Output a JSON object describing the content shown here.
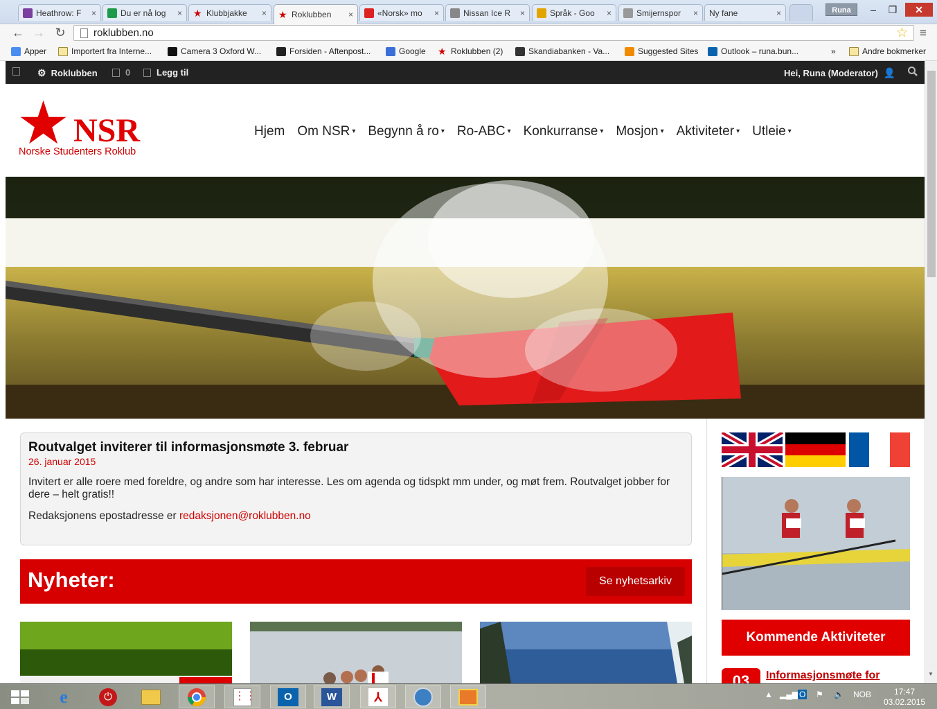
{
  "browser": {
    "tabs": [
      {
        "title": "Heathrow: F",
        "icon": "calendar-icon",
        "color": "#7b3fa0"
      },
      {
        "title": "Du er nå log",
        "icon": "green-h-icon",
        "color": "#1e9a4a"
      },
      {
        "title": "Klubbjakke",
        "icon": "star-icon",
        "color": "#d00000"
      },
      {
        "title": "Roklubben",
        "icon": "star-icon",
        "color": "#d00000"
      },
      {
        "title": "«Norsk» mo",
        "icon": "vg-icon",
        "color": "#d22"
      },
      {
        "title": "Nissan Ice R",
        "icon": "nissan-icon",
        "color": "#888"
      },
      {
        "title": "Språk - Goo",
        "icon": "chart-icon",
        "color": "#e2a400"
      },
      {
        "title": "Smijernspor",
        "icon": "page-icon",
        "color": "#999"
      },
      {
        "title": "Ny fane",
        "icon": "",
        "color": ""
      }
    ],
    "tab_close": "×",
    "user_button": "Runa",
    "url": "roklubben.no",
    "nav": {
      "back": "←",
      "forward": "→",
      "reload": "↻"
    },
    "star": "☆",
    "menu": "≡",
    "bookmarks": [
      {
        "label": "Apper",
        "icon": "apps-icon"
      },
      {
        "label": "Importert fra Interne...",
        "icon": "folder-icon"
      },
      {
        "label": "Camera 3 Oxford W...",
        "icon": "oi-icon"
      },
      {
        "label": "Forsiden - Aftenpost...",
        "icon": "aftenposten-icon"
      },
      {
        "label": "Google",
        "icon": "google-icon"
      },
      {
        "label": "Roklubben (2)",
        "icon": "star-icon"
      },
      {
        "label": "Skandiabanken - Va...",
        "icon": "skandia-icon"
      },
      {
        "label": "Suggested Sites",
        "icon": "suggested-icon"
      },
      {
        "label": "Outlook – runa.bun...",
        "icon": "outlook-icon"
      }
    ],
    "bookmarks_more": "»",
    "other_bookmarks": "Andre bokmerker"
  },
  "adminbar": {
    "site": "Roklubben",
    "comments": "0",
    "add": "Legg til",
    "greeting": "Hei, Runa (Moderator)"
  },
  "site": {
    "logo_text": "NSR",
    "logo_sub": "Norske Studenters Roklub",
    "nav": [
      {
        "label": "Hjem",
        "dropdown": false
      },
      {
        "label": "Om NSR",
        "dropdown": true
      },
      {
        "label": "Begynn å ro",
        "dropdown": true
      },
      {
        "label": "Ro-ABC",
        "dropdown": true
      },
      {
        "label": "Konkurranse",
        "dropdown": true
      },
      {
        "label": "Mosjon",
        "dropdown": true
      },
      {
        "label": "Aktiviteter",
        "dropdown": true
      },
      {
        "label": "Utleie",
        "dropdown": true
      }
    ]
  },
  "notice": {
    "title": "Routvalget inviterer til informasjonsmøte 3. februar",
    "date": "26. januar 2015",
    "body": "Invitert er alle roere med foreldre, og andre som har interesse. Les om agenda og tidspkt mm under, og møt frem. Routvalget jobber for dere – helt gratis!!",
    "contact_prefix": "Redaksjonens epostadresse er ",
    "contact_email": "redaksjonen@roklubben.no"
  },
  "news": {
    "heading": "Nyheter:",
    "archive_button": "Se nyhetsarkiv"
  },
  "sidebar": {
    "activities_button": "Kommende Aktiviteter",
    "event_day": "03",
    "event_title": "Informasjonsmøte for"
  },
  "taskbar": {
    "lang": "NOB",
    "time": "17:47",
    "date": "03.02.2015"
  },
  "colors": {
    "brand_red": "#e00000",
    "admin_bar": "#222222"
  }
}
